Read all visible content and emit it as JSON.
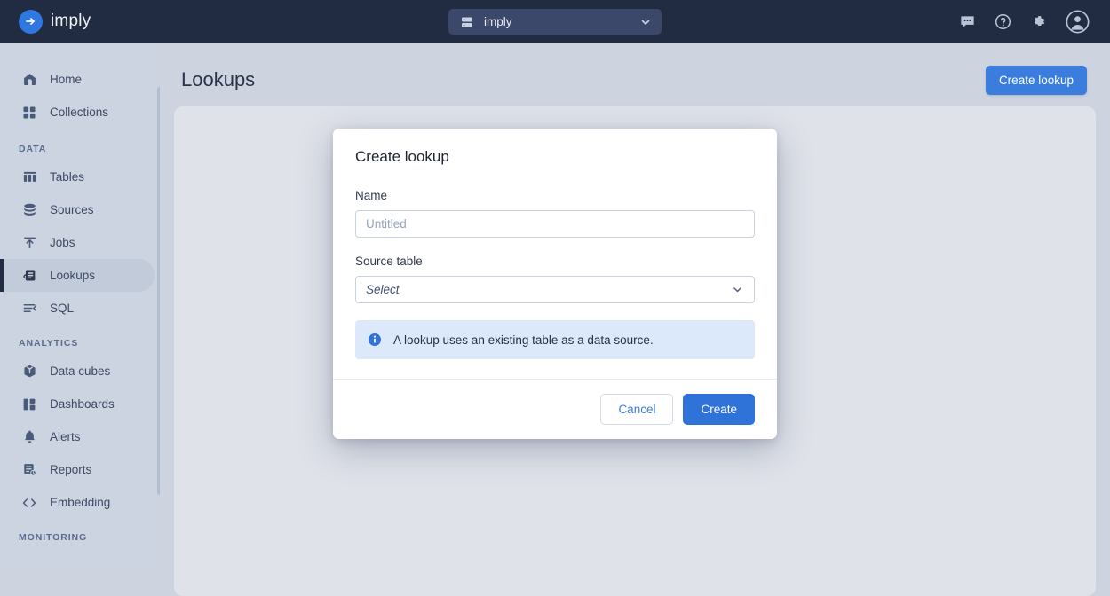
{
  "colors": {
    "accent": "#3b7ddd",
    "topbar_bg": "#212c42",
    "sidebar_bg": "#ccd4e1",
    "panel_bg": "#dfe2e9",
    "info_bg": "#dbe9fb",
    "active_item_bg": "#c2cbda"
  },
  "topbar": {
    "brand": "imply",
    "brand_icon": "arrow-right-circle-icon",
    "cluster": {
      "icon": "server-icon",
      "name": "imply",
      "caret_icon": "chevron-down-icon"
    },
    "actions": [
      {
        "name": "feedback-icon",
        "label": "Feedback"
      },
      {
        "name": "help-icon",
        "label": "Help"
      },
      {
        "name": "gear-icon",
        "label": "Settings"
      },
      {
        "name": "account-avatar-icon",
        "label": "Account"
      }
    ]
  },
  "sidebar": {
    "items": [
      {
        "label": "Home",
        "icon": "home-icon",
        "active": false
      },
      {
        "label": "Collections",
        "icon": "collections-icon",
        "active": false
      }
    ],
    "groups": [
      {
        "label": "DATA",
        "items": [
          {
            "label": "Tables",
            "icon": "table-icon",
            "active": false
          },
          {
            "label": "Sources",
            "icon": "database-icon",
            "active": false
          },
          {
            "label": "Jobs",
            "icon": "upload-icon",
            "active": false
          },
          {
            "label": "Lookups",
            "icon": "lookups-icon",
            "active": true
          },
          {
            "label": "SQL",
            "icon": "sql-icon",
            "active": false
          }
        ]
      },
      {
        "label": "ANALYTICS",
        "items": [
          {
            "label": "Data cubes",
            "icon": "cube-icon",
            "active": false
          },
          {
            "label": "Dashboards",
            "icon": "dashboard-icon",
            "active": false
          },
          {
            "label": "Alerts",
            "icon": "bell-icon",
            "active": false
          },
          {
            "label": "Reports",
            "icon": "report-icon",
            "active": false
          },
          {
            "label": "Embedding",
            "icon": "code-icon",
            "active": false
          }
        ]
      },
      {
        "label": "MONITORING",
        "items": []
      }
    ]
  },
  "page": {
    "title": "Lookups",
    "create_button": "Create lookup"
  },
  "modal": {
    "title": "Create lookup",
    "name_field": {
      "label": "Name",
      "value": "",
      "placeholder": "Untitled"
    },
    "source_table_field": {
      "label": "Source table",
      "value": "Select",
      "caret_icon": "chevron-down-icon"
    },
    "info": {
      "icon": "info-icon",
      "text": "A lookup uses an existing table as a data source."
    },
    "cancel_button": "Cancel",
    "create_button": "Create"
  }
}
